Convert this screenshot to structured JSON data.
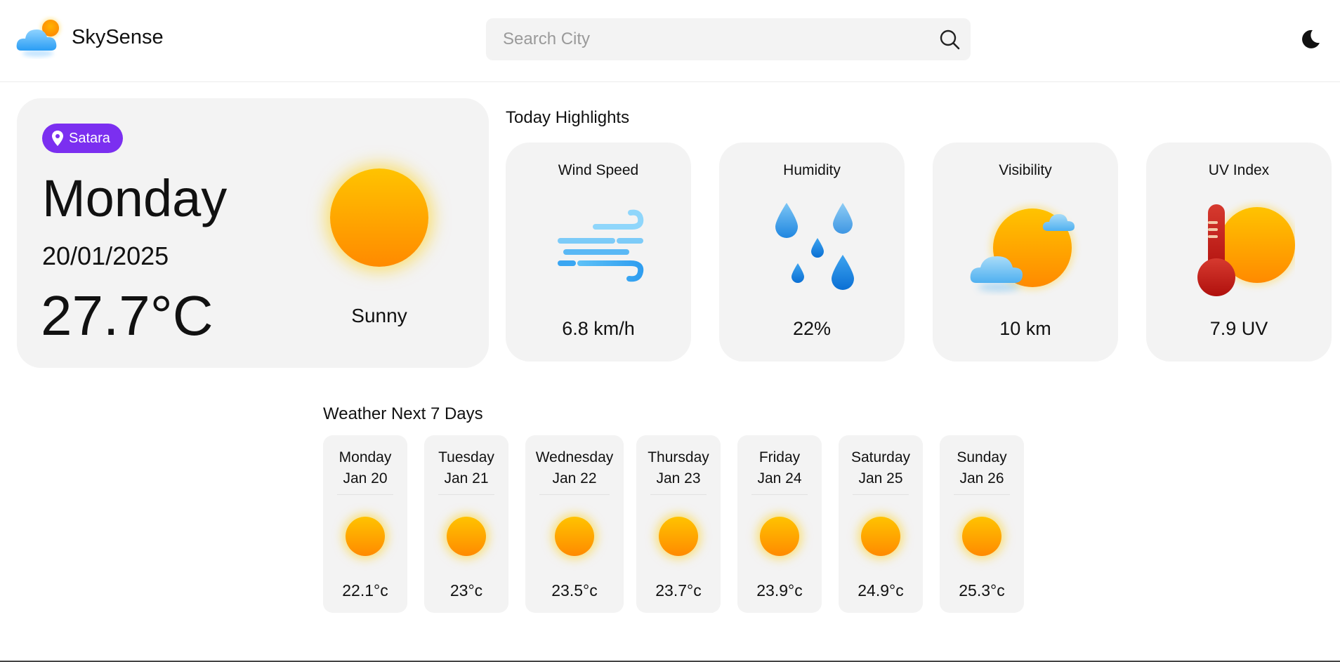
{
  "app": {
    "name": "SkySense"
  },
  "search": {
    "placeholder": "Search City"
  },
  "current": {
    "location": "Satara",
    "day": "Monday",
    "date": "20/01/2025",
    "temperature": "27.7°C",
    "condition": "Sunny"
  },
  "highlights": {
    "title": "Today Highlights",
    "items": [
      {
        "label": "Wind Speed",
        "value": "6.8 km/h",
        "icon": "wind-icon"
      },
      {
        "label": "Humidity",
        "value": "22%",
        "icon": "raindrops-icon"
      },
      {
        "label": "Visibility",
        "value": "10 km",
        "icon": "sun-cloud-icon"
      },
      {
        "label": "UV Index",
        "value": "7.9 UV",
        "icon": "thermometer-sun-icon"
      }
    ]
  },
  "forecast": {
    "title": "Weather Next 7 Days",
    "days": [
      {
        "day": "Monday",
        "date": "Jan 20",
        "temp": "22.1°c",
        "icon": "sun-icon"
      },
      {
        "day": "Tuesday",
        "date": "Jan 21",
        "temp": "23°c",
        "icon": "sun-icon"
      },
      {
        "day": "Wednesday",
        "date": "Jan 22",
        "temp": "23.5°c",
        "icon": "sun-icon"
      },
      {
        "day": "Thursday",
        "date": "Jan 23",
        "temp": "23.7°c",
        "icon": "sun-icon"
      },
      {
        "day": "Friday",
        "date": "Jan 24",
        "temp": "23.9°c",
        "icon": "sun-icon"
      },
      {
        "day": "Saturday",
        "date": "Jan 25",
        "temp": "24.9°c",
        "icon": "sun-icon"
      },
      {
        "day": "Sunday",
        "date": "Jan 26",
        "temp": "25.3°c",
        "icon": "sun-icon"
      }
    ]
  },
  "colors": {
    "location_pill": "#7b2ff0",
    "card_bg": "#f3f3f3",
    "sun_top": "#ffc300",
    "sun_bottom": "#ff8a00"
  }
}
